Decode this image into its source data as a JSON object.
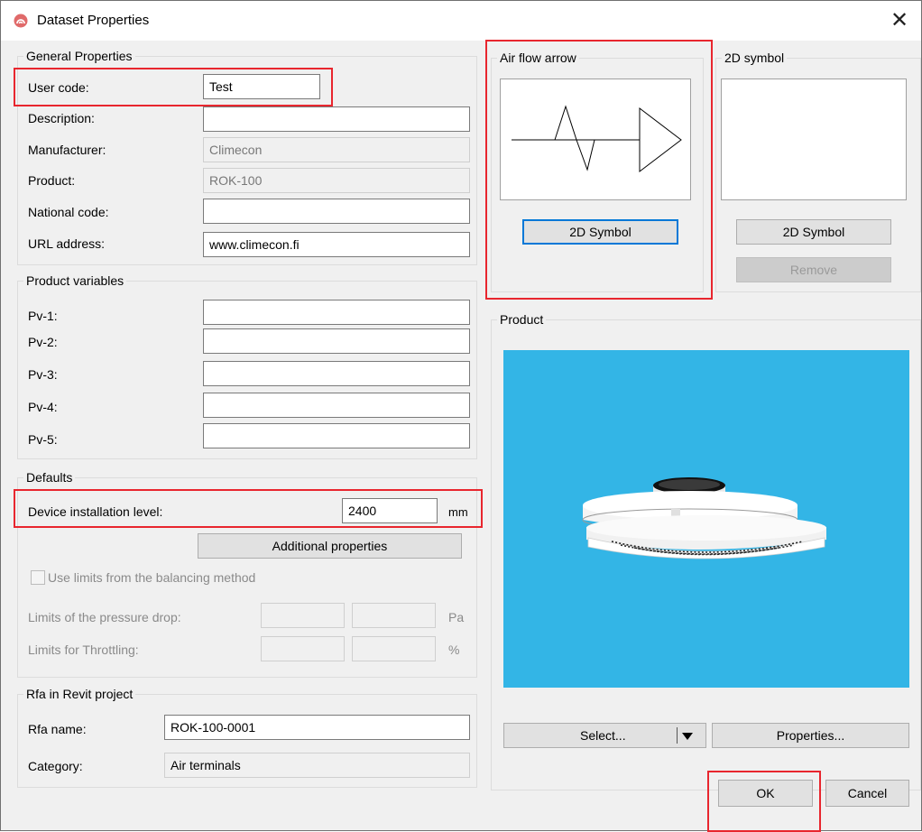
{
  "window": {
    "title": "Dataset Properties",
    "close_glyph": "✕"
  },
  "general": {
    "legend": "General Properties",
    "user_code_label": "User code:",
    "user_code_value": "Test",
    "description_label": "Description:",
    "description_value": "",
    "manufacturer_label": "Manufacturer:",
    "manufacturer_value": "Climecon",
    "product_label": "Product:",
    "product_value": "ROK-100",
    "national_code_label": "National code:",
    "national_code_value": "",
    "url_label": "URL address:",
    "url_value": "www.climecon.fi"
  },
  "product_variables": {
    "legend": "Product variables",
    "items": [
      {
        "label": "Pv-1:",
        "value": ""
      },
      {
        "label": "Pv-2:",
        "value": ""
      },
      {
        "label": "Pv-3:",
        "value": ""
      },
      {
        "label": "Pv-4:",
        "value": ""
      },
      {
        "label": "Pv-5:",
        "value": ""
      }
    ]
  },
  "defaults": {
    "legend": "Defaults",
    "install_level_label": "Device installation level:",
    "install_level_value": "2400",
    "install_level_unit": "mm",
    "additional_btn": "Additional properties",
    "use_limits_label": "Use limits from the balancing method",
    "pressure_drop_label": "Limits of the pressure drop:",
    "pressure_unit": "Pa",
    "throttling_label": "Limits for Throttling:",
    "throttling_unit": "%"
  },
  "rfa": {
    "legend": "Rfa in Revit project",
    "name_label": "Rfa name:",
    "name_value": "ROK-100-0001",
    "category_label": "Category:",
    "category_value": "Air terminals"
  },
  "airflow": {
    "legend": "Air flow arrow",
    "button": "2D Symbol"
  },
  "symbol2d": {
    "legend": "2D symbol",
    "button": "2D Symbol",
    "remove": "Remove"
  },
  "product": {
    "legend": "Product",
    "select_btn": "Select...",
    "properties_btn": "Properties...",
    "viewport_color": "#33b5e6"
  },
  "footer": {
    "ok": "OK",
    "cancel": "Cancel"
  },
  "colors": {
    "highlight": "#e8262e",
    "focus": "#0078d7"
  }
}
